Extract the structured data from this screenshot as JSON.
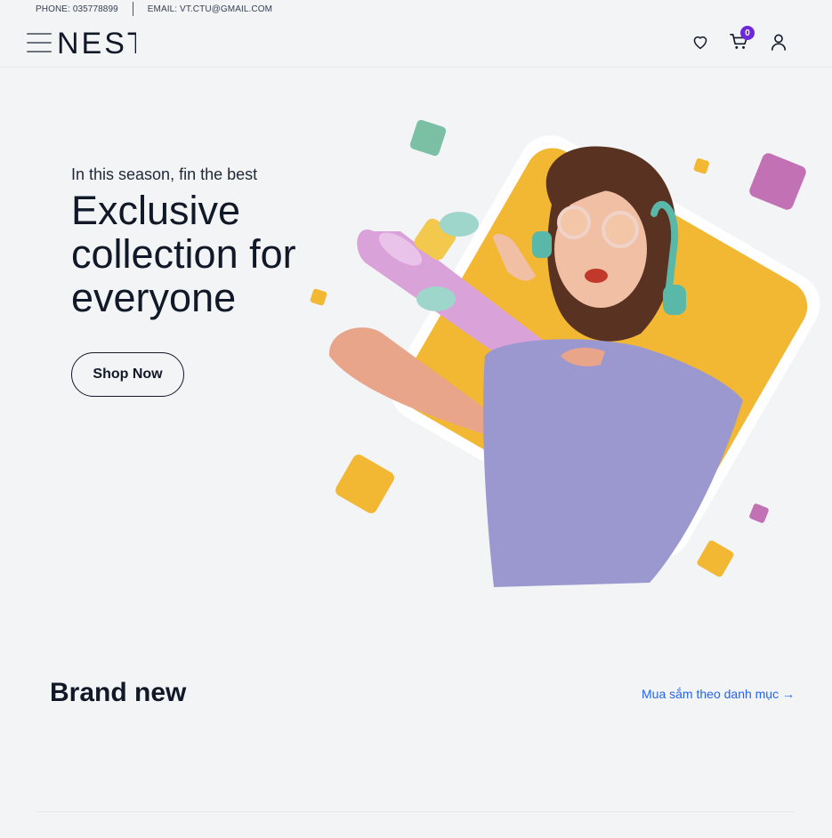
{
  "topbar": {
    "phone": "PHONE: 035778899",
    "email": "EMAIL: VT.CTU@GMAIL.COM"
  },
  "header": {
    "logo": "NEST",
    "cart_count": "0",
    "icons": [
      "menu-icon",
      "heart-icon",
      "cart-icon",
      "user-icon"
    ]
  },
  "hero": {
    "subtitle": "In this season, fin the best",
    "title": "Exclusive collection for everyone",
    "cta": "Shop Now"
  },
  "brand_section": {
    "title": "Brand new",
    "link": "Mua sắm theo danh mục →"
  },
  "colors": {
    "accent": "#6d28d9",
    "link": "#2563eb",
    "hero_yellow": "#f2b733",
    "teal": "#7bbfa5",
    "pink": "#c271b4",
    "lilac": "#9b98d0"
  }
}
